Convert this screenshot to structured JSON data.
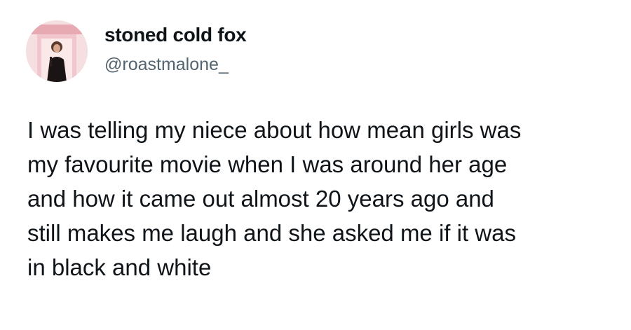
{
  "author": {
    "display_name": "stoned cold fox",
    "handle": "@roastmalone_",
    "avatar_icon": "profile-photo"
  },
  "tweet": {
    "lines": [
      "I was telling my niece about how mean girls was",
      "my favourite movie when I was around her age",
      "and how it came out almost 20 years ago and",
      "still makes me laugh and she asked me if it was",
      "in black and white"
    ]
  },
  "colors": {
    "text_primary": "#0f1419",
    "text_secondary": "#536471",
    "background": "#ffffff",
    "avatar_bg": "#f4d6d8"
  }
}
